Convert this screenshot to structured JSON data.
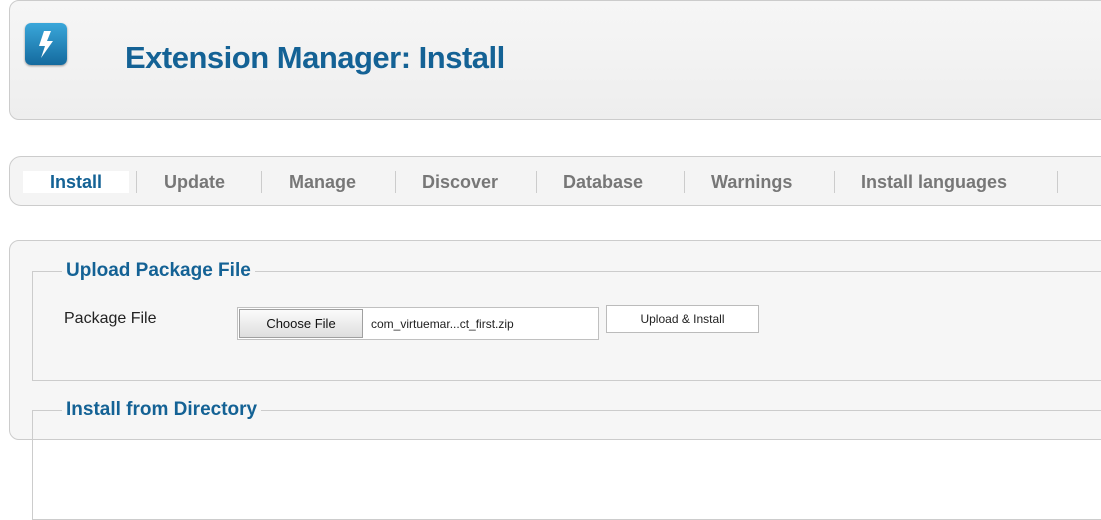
{
  "header": {
    "title": "Extension Manager: Install",
    "icon": "lightning-bolt-icon",
    "icon_color": "#2a8cc4"
  },
  "tabs": [
    {
      "label": "Install",
      "active": true
    },
    {
      "label": "Update",
      "active": false
    },
    {
      "label": "Manage",
      "active": false
    },
    {
      "label": "Discover",
      "active": false
    },
    {
      "label": "Database",
      "active": false
    },
    {
      "label": "Warnings",
      "active": false
    },
    {
      "label": "Install languages",
      "active": false
    }
  ],
  "upload_section": {
    "legend": "Upload Package File",
    "field_label": "Package File",
    "choose_button": "Choose File",
    "selected_file": "com_virtuemar...ct_first.zip",
    "upload_button": "Upload & Install"
  },
  "directory_section": {
    "legend": "Install from Directory"
  },
  "colors": {
    "accent": "#146295",
    "tab_inactive": "#777777",
    "border": "#cccccc"
  }
}
